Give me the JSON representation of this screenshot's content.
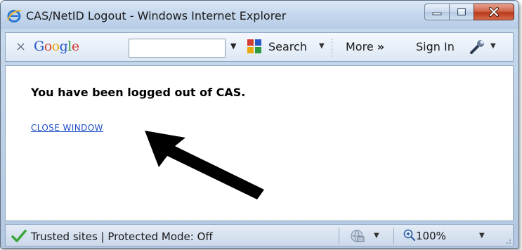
{
  "window": {
    "title": "CAS/NetID Logout - Windows Internet Explorer",
    "controls": [
      "minimize",
      "maximize",
      "close"
    ]
  },
  "toolbar": {
    "close_glyph": "×",
    "brand": "Google",
    "search_value": "",
    "search_label": "Search",
    "more_label": "More",
    "more_glyph": "»",
    "signin_label": "Sign In",
    "dropdown_glyph": "▼"
  },
  "page": {
    "heading": "You have been logged out of CAS.",
    "close_link": "CLOSE WINDOW"
  },
  "statusbar": {
    "status_text": "Trusted sites | Protected Mode: Off",
    "zoom": "100%"
  },
  "colors": {
    "accent_link": "#1b4dc5",
    "titlebar": "#c6d8ee",
    "close_button": "#c8482a",
    "check": "#3aa53a"
  },
  "icons": [
    "ie-logo-icon",
    "google-toolbar-icon",
    "wrench-icon",
    "check-icon",
    "globe-icon",
    "zoom-icon",
    "arrow-annotation"
  ]
}
